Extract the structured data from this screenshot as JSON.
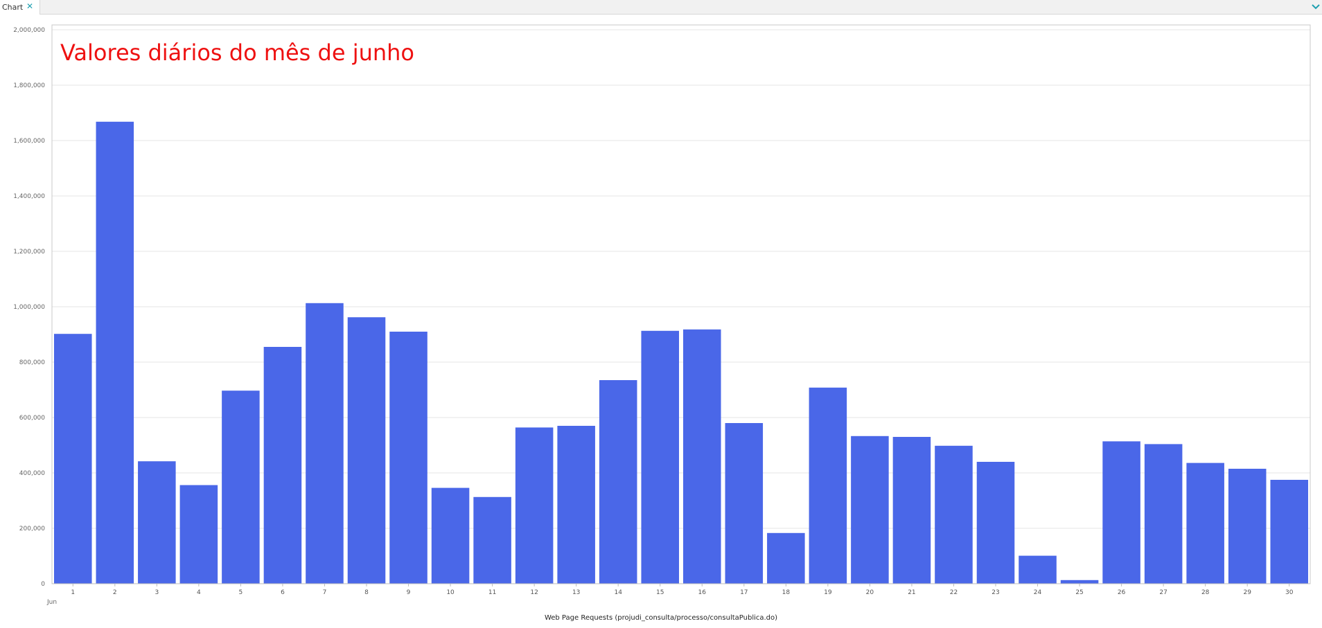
{
  "tab": {
    "label": "Chart",
    "close_glyph": "✕",
    "close_icon": "close-icon",
    "menu_icon": "chevron-down-icon"
  },
  "colors": {
    "bar": "#4a67e8",
    "title": "#ee1111",
    "accent": "#1fa0b0"
  },
  "chart_data": {
    "type": "bar",
    "title": "Valores diários do mês de junho",
    "xlabel": "Web Page Requests (projudi_consulta/processo/consultaPublica.do)",
    "ylabel": "",
    "x_period_label": "Jun",
    "ylim": [
      0,
      2000000
    ],
    "yticks": [
      0,
      200000,
      400000,
      600000,
      800000,
      1000000,
      1200000,
      1400000,
      1600000,
      1800000,
      2000000
    ],
    "grid": true,
    "legend": "none",
    "categories": [
      "1",
      "2",
      "3",
      "4",
      "5",
      "6",
      "7",
      "8",
      "9",
      "10",
      "11",
      "12",
      "13",
      "14",
      "15",
      "16",
      "17",
      "18",
      "19",
      "20",
      "21",
      "22",
      "23",
      "24",
      "25",
      "26",
      "27",
      "28",
      "29",
      "30"
    ],
    "values": [
      902000,
      1668000,
      442000,
      356000,
      697000,
      855000,
      1013000,
      962000,
      910000,
      346000,
      313000,
      564000,
      570000,
      735000,
      913000,
      918000,
      580000,
      183000,
      708000,
      533000,
      530000,
      498000,
      440000,
      101000,
      13000,
      514000,
      504000,
      436000,
      415000,
      375000
    ]
  }
}
